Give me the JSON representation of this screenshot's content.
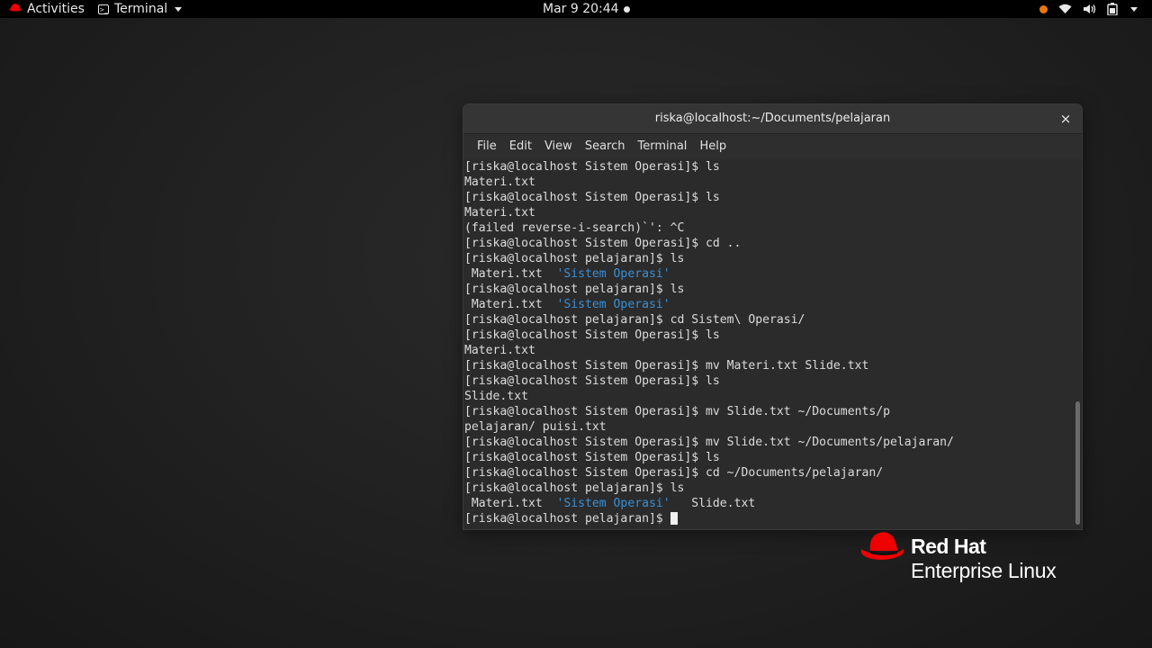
{
  "topbar": {
    "activities_label": "Activities",
    "app_menu_label": "Terminal",
    "clock": "Mar 9  20:44",
    "colors": {
      "recording_dot": "#e8790f"
    },
    "tray_icons": [
      "recording-indicator-icon",
      "wifi-icon",
      "volume-icon",
      "battery-icon",
      "system-menu-chevron-icon"
    ]
  },
  "terminal": {
    "title": "riska@localhost:~/Documents/pelajaran",
    "close_glyph": "×",
    "menu": [
      "File",
      "Edit",
      "View",
      "Search",
      "Terminal",
      "Help"
    ],
    "lines": [
      [
        {
          "t": "[riska@localhost Sistem Operasi]$ ls"
        }
      ],
      [
        {
          "t": "Materi.txt"
        }
      ],
      [
        {
          "t": "[riska@localhost Sistem Operasi]$ ls"
        }
      ],
      [
        {
          "t": "Materi.txt"
        }
      ],
      [
        {
          "t": "(failed reverse-i-search)`': ^C"
        }
      ],
      [
        {
          "t": "[riska@localhost Sistem Operasi]$ cd .."
        }
      ],
      [
        {
          "t": "[riska@localhost pelajaran]$ ls"
        }
      ],
      [
        {
          "t": " Materi.txt  "
        },
        {
          "t": "'Sistem Operasi'",
          "c": "blue"
        }
      ],
      [
        {
          "t": "[riska@localhost pelajaran]$ ls"
        }
      ],
      [
        {
          "t": " Materi.txt  "
        },
        {
          "t": "'Sistem Operasi'",
          "c": "blue"
        }
      ],
      [
        {
          "t": "[riska@localhost pelajaran]$ cd Sistem\\ Operasi/"
        }
      ],
      [
        {
          "t": "[riska@localhost Sistem Operasi]$ ls"
        }
      ],
      [
        {
          "t": "Materi.txt"
        }
      ],
      [
        {
          "t": "[riska@localhost Sistem Operasi]$ mv Materi.txt Slide.txt"
        }
      ],
      [
        {
          "t": "[riska@localhost Sistem Operasi]$ ls"
        }
      ],
      [
        {
          "t": "Slide.txt"
        }
      ],
      [
        {
          "t": "[riska@localhost Sistem Operasi]$ mv Slide.txt ~/Documents/p"
        }
      ],
      [
        {
          "t": "pelajaran/ puisi.txt"
        }
      ],
      [
        {
          "t": "[riska@localhost Sistem Operasi]$ mv Slide.txt ~/Documents/pelajaran/"
        }
      ],
      [
        {
          "t": "[riska@localhost Sistem Operasi]$ ls"
        }
      ],
      [
        {
          "t": "[riska@localhost Sistem Operasi]$ cd ~/Documents/pelajaran/"
        }
      ],
      [
        {
          "t": "[riska@localhost pelajaran]$ ls"
        }
      ],
      [
        {
          "t": " Materi.txt  "
        },
        {
          "t": "'Sistem Operasi'",
          "c": "blue"
        },
        {
          "t": "   Slide.txt"
        }
      ],
      [
        {
          "t": "[riska@localhost pelajaran]$ "
        },
        {
          "cursor": true
        }
      ]
    ],
    "colors": {
      "dir_blue": "#3a90d6",
      "background": "#2b2b2b"
    }
  },
  "branding": {
    "line1": "Red Hat",
    "line2": "Enterprise Linux",
    "logo_color": "#ee0000"
  }
}
